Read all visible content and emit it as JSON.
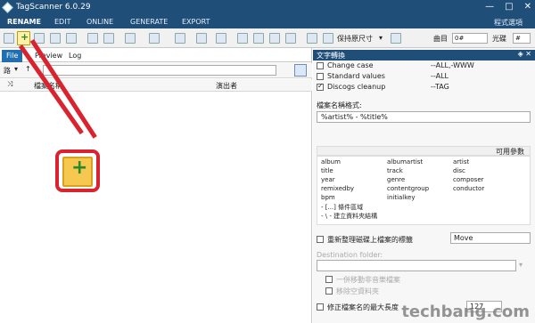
{
  "app": {
    "title": "TagScanner 6.0.29"
  },
  "window_controls": {
    "minimize": "—",
    "maximize": "□",
    "close": "✕"
  },
  "menu": {
    "items": [
      "RENAME",
      "EDIT",
      "ONLINE",
      "GENERATE",
      "EXPORT"
    ],
    "active": "RENAME",
    "options": "程式選項"
  },
  "toolbar": {
    "keep_size": "保持原尺寸",
    "track_label": "曲目",
    "track_value": "0#",
    "disc_label": "光碟",
    "disc_value": "#"
  },
  "left": {
    "tabs": [
      "File",
      "Preview",
      "Log"
    ],
    "path_label": "路",
    "path_value": "",
    "columns": [
      "檔案名稱",
      "演出者"
    ]
  },
  "right": {
    "title": "文字轉換",
    "transforms": [
      {
        "checked": false,
        "name": "Change case",
        "value": "--ALL,-WWW"
      },
      {
        "checked": false,
        "name": "Standard values",
        "value": "--ALL"
      },
      {
        "checked": true,
        "name": "Discogs cleanup",
        "value": "--TAG"
      }
    ],
    "format_label": "檔案名稱格式:",
    "format_value": "%artist% - %title%",
    "available_label": "可用參數",
    "available": [
      [
        "album",
        "albumartist",
        "artist"
      ],
      [
        "title",
        "track",
        "disc"
      ],
      [
        "year",
        "genre",
        "composer"
      ],
      [
        "remixedby",
        "contentgroup",
        "conductor"
      ],
      [
        "bpm",
        "initialkey",
        ""
      ],
      [
        "- [...] 條件區域",
        "",
        ""
      ],
      [
        "- \\ - 建立資料夾結構",
        "",
        ""
      ]
    ],
    "reorg_label": "重新整理磁碟上檔案的標籤",
    "move_value": "Move",
    "dest_label": "Destination folder:",
    "move_music": "一併移動非音樂檔案",
    "remove_empty": "移除空資料夾",
    "max_len_label": "修正檔案名的最大長度",
    "max_len_value": "127"
  },
  "watermark": "techbang.com"
}
